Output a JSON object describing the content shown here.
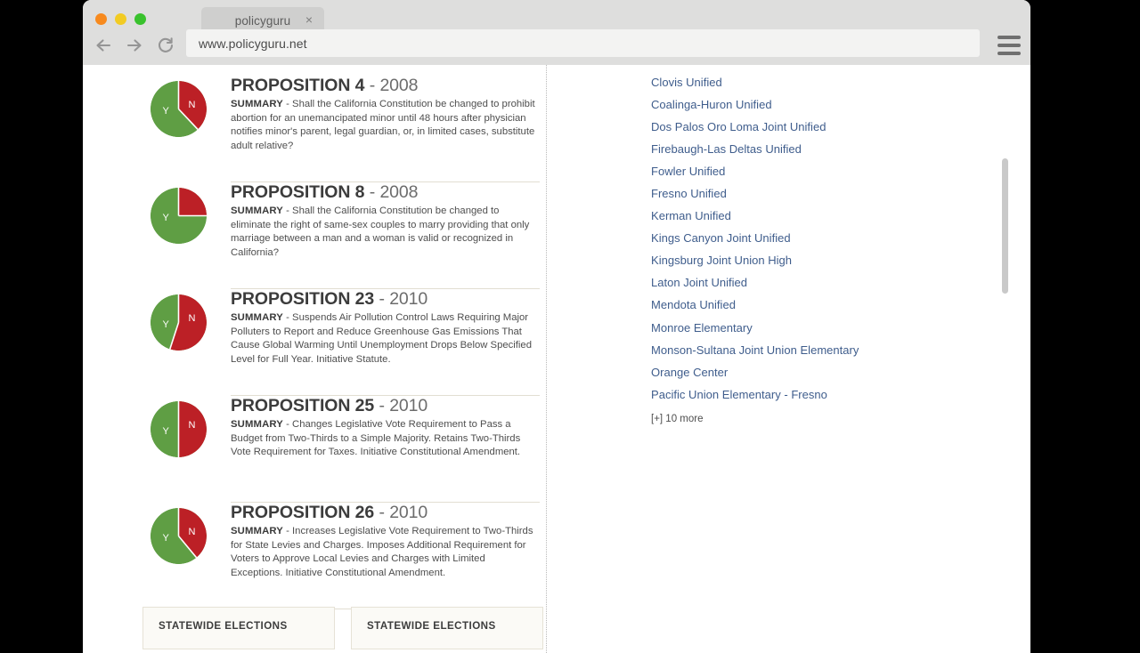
{
  "browser": {
    "tab_title": "policyguru",
    "tab_close_label": "×",
    "url": "www.policyguru.net",
    "back_icon": "back-arrow-icon",
    "forward_icon": "forward-arrow-icon",
    "reload_icon": "reload-icon",
    "menu_icon": "hamburger-menu-icon"
  },
  "propositions": [
    {
      "title": "PROPOSITION 4",
      "dash": " - ",
      "year": "2008",
      "summary_label": "SUMMARY",
      "summary_dash": " - ",
      "summary": "Shall the California Constitution be changed to prohibit abortion for an unemancipated minor until 48 hours after physician notifies minor's parent, legal guardian, or, in limited cases, substitute adult relative?",
      "yes_label": "Y",
      "no_label": "N",
      "yes_pct": 62,
      "no_pct": 38,
      "show_no_label": true
    },
    {
      "title": "PROPOSITION 8",
      "dash": " - ",
      "year": "2008",
      "summary_label": "SUMMARY",
      "summary_dash": " - ",
      "summary": "Shall the California Constitution be changed to eliminate the right of same-sex couples to marry providing that only marriage between a man and a woman is valid or recognized in California?",
      "yes_label": "Y",
      "no_label": "N",
      "yes_pct": 75,
      "no_pct": 25,
      "show_no_label": false
    },
    {
      "title": "PROPOSITION 23",
      "dash": " - ",
      "year": "2010",
      "summary_label": "SUMMARY",
      "summary_dash": " - ",
      "summary": "Suspends Air Pollution Control Laws Requiring Major Polluters to Report and Reduce Greenhouse Gas Emissions That Cause Global Warming Until Unemployment Drops Below Specified Level for Full Year. Initiative Statute.",
      "yes_label": "Y",
      "no_label": "N",
      "yes_pct": 45,
      "no_pct": 55,
      "show_no_label": true
    },
    {
      "title": "PROPOSITION 25",
      "dash": " - ",
      "year": "2010",
      "summary_label": "SUMMARY",
      "summary_dash": " - ",
      "summary": "Changes Legislative Vote Requirement to Pass a Budget from Two-Thirds to a Simple Majority. Retains Two-Thirds Vote Requirement for Taxes. Initiative Constitutional Amendment.",
      "yes_label": "Y",
      "no_label": "N",
      "yes_pct": 50,
      "no_pct": 50,
      "show_no_label": true
    },
    {
      "title": "PROPOSITION 26",
      "dash": " - ",
      "year": "2010",
      "summary_label": "SUMMARY",
      "summary_dash": " - ",
      "summary": "Increases Legislative Vote Requirement to Two-Thirds for State Levies and Charges. Imposes Additional Requirement for Voters to Approve Local Levies and Charges with Limited Exceptions. Initiative Constitutional Amendment.",
      "yes_label": "Y",
      "no_label": "N",
      "yes_pct": 61,
      "no_pct": 39,
      "show_no_label": true
    }
  ],
  "districts": {
    "items": [
      "Clovis Unified",
      "Coalinga-Huron Unified",
      "Dos Palos Oro Loma Joint Unified",
      "Firebaugh-Las Deltas Unified",
      "Fowler Unified",
      "Fresno Unified",
      "Kerman Unified",
      "Kings Canyon Joint Unified",
      "Kingsburg Joint Union High",
      "Laton Joint Unified",
      "Mendota Unified",
      "Monroe Elementary",
      "Monson-Sultana Joint Union Elementary",
      "Orange Center",
      "Pacific Union Elementary - Fresno"
    ],
    "more_label": "[+] 10 more"
  },
  "bottom_cards": [
    {
      "title": "STATEWIDE ELECTIONS"
    },
    {
      "title": "STATEWIDE ELECTIONS"
    }
  ],
  "colors": {
    "yes_green": "#5f9e44",
    "no_red": "#bc2026",
    "link_blue": "#3f5d8c",
    "chrome_gray": "#dededd"
  }
}
